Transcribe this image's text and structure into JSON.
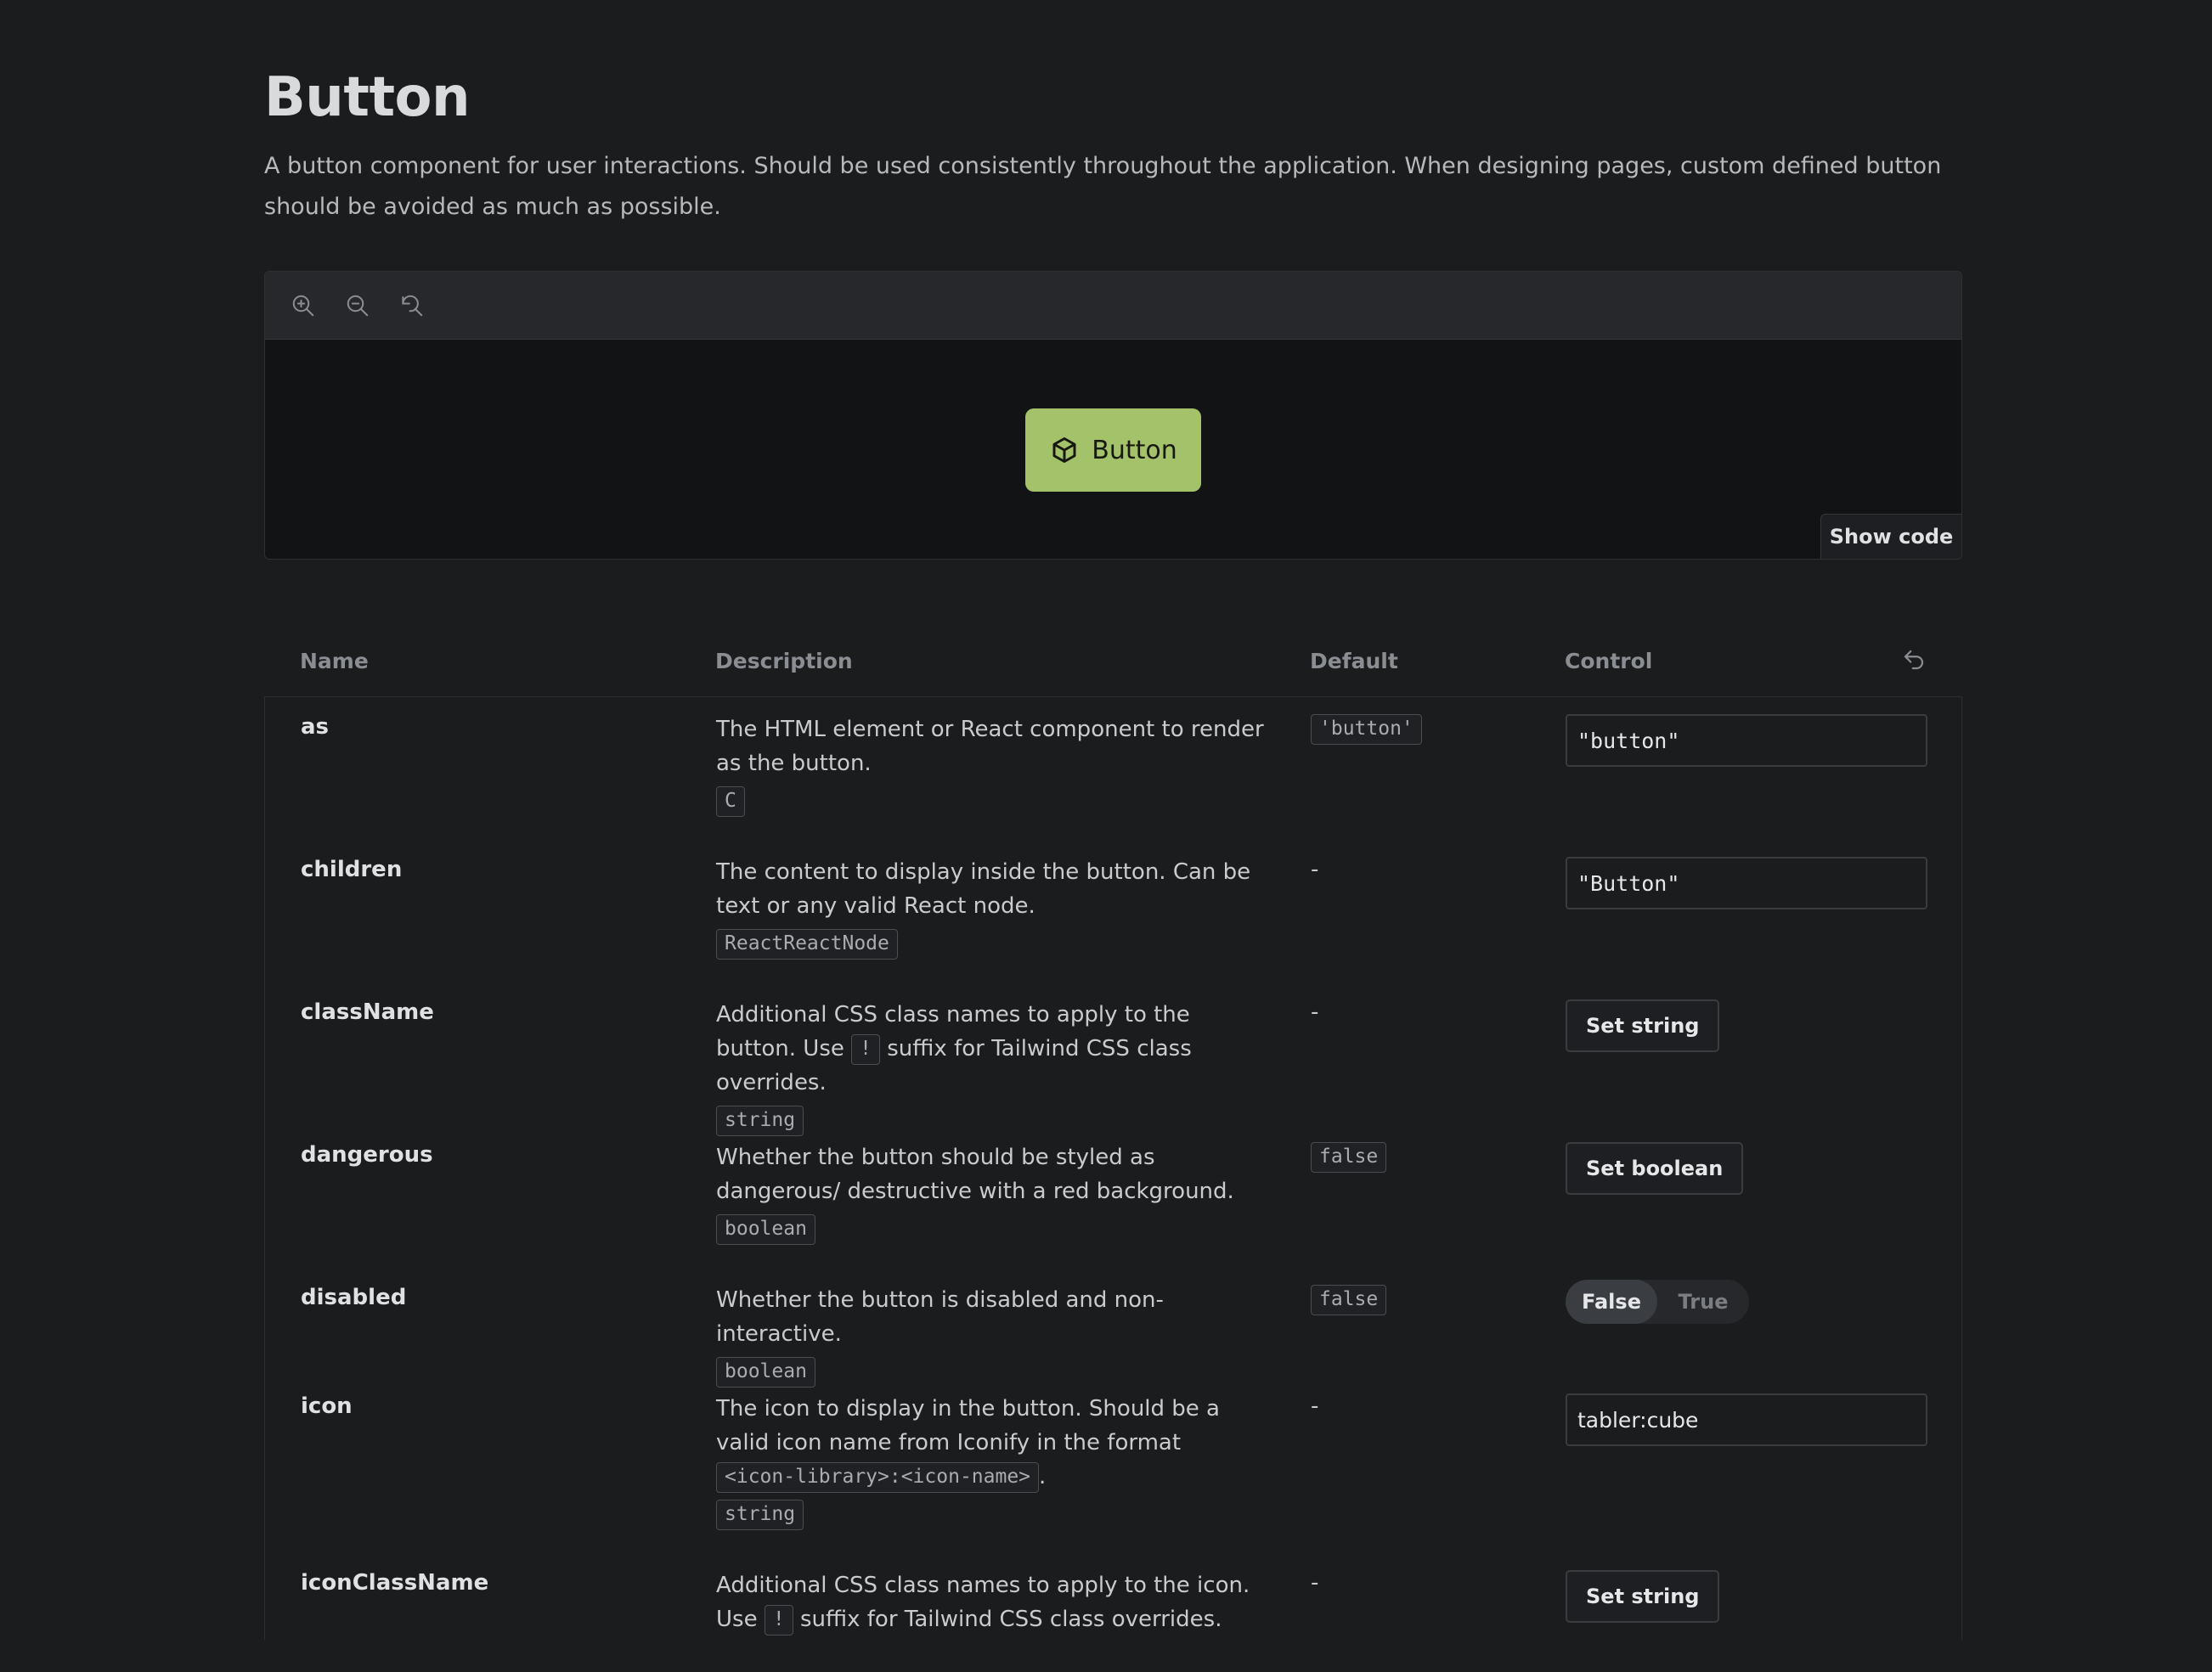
{
  "page": {
    "title": "Button",
    "description": "A button component for user interactions. Should be used consistently throughout the application. When designing pages, custom defined button should be avoided as much as possible."
  },
  "preview": {
    "toolbar": {
      "icons": [
        "zoom-in-icon",
        "zoom-out-icon",
        "reset-zoom-icon"
      ]
    },
    "demo_button_label": "Button",
    "demo_button_icon": "cube-icon",
    "demo_button_color": "#a4c26a",
    "show_code_label": "Show code"
  },
  "table": {
    "headers": {
      "name": "Name",
      "description": "Description",
      "default": "Default",
      "control": "Control"
    },
    "rows": [
      {
        "name": "as",
        "description": "The HTML element or React component to render as the button.",
        "type": "C",
        "default": "'button'",
        "control_value": "\"button\""
      },
      {
        "name": "children",
        "description": "The content to display inside the button. Can be text or any valid React node.",
        "type": "ReactReactNode",
        "default": "-",
        "control_value": "\"Button\""
      },
      {
        "name": "className",
        "description_pre": "Additional CSS class names to apply to the button. Use",
        "description_code": "!",
        "description_post": "suffix for Tailwind CSS class overrides.",
        "type": "string",
        "default": "-",
        "control_label": "Set string"
      },
      {
        "name": "dangerous",
        "description": "Whether the button should be styled as dangerous/ destructive with a red background.",
        "type": "boolean",
        "default": "false",
        "control_label": "Set boolean"
      },
      {
        "name": "disabled",
        "description": "Whether the button is disabled and non-interactive.",
        "type": "boolean",
        "default": "false",
        "toggle_false": "False",
        "toggle_true": "True",
        "toggle_selected": "False"
      },
      {
        "name": "icon",
        "description_pre": "The icon to display in the button. Should be a valid icon name from Iconify in the format",
        "description_code": "<icon-library>:<icon-name>",
        "description_post": ".",
        "type": "string",
        "default": "-",
        "control_value": "tabler:cube"
      },
      {
        "name": "iconClassName",
        "description_pre": "Additional CSS class names to apply to the icon. Use",
        "description_code": "!",
        "description_post": "suffix for Tailwind CSS class overrides.",
        "default": "-",
        "control_label": "Set string"
      }
    ]
  }
}
